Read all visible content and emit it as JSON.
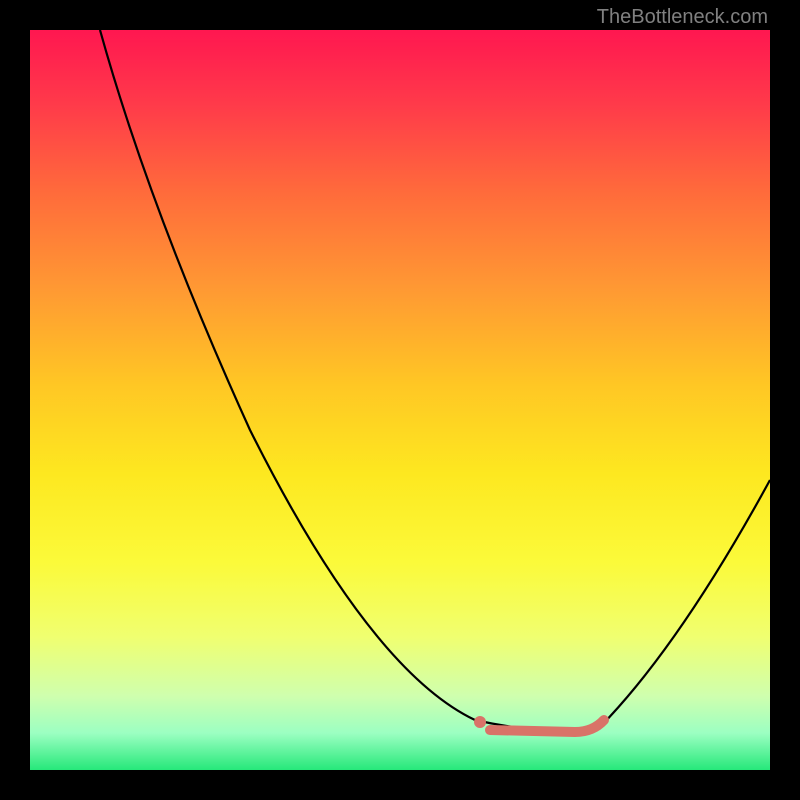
{
  "watermark": "TheBottleneck.com",
  "chart_data": {
    "type": "line",
    "title": "",
    "xlabel": "",
    "ylabel": "",
    "xlim": [
      0,
      100
    ],
    "ylim": [
      0,
      100
    ],
    "background_gradient": {
      "top": "#ff1750",
      "bottom": "#26e87a",
      "meaning": "red=high bottleneck, green=low bottleneck"
    },
    "series": [
      {
        "name": "bottleneck-curve",
        "x": [
          9,
          15,
          25,
          35,
          45,
          55,
          60,
          65,
          70,
          75,
          78,
          85,
          92,
          100
        ],
        "values": [
          100,
          85,
          65,
          48,
          32,
          15,
          8,
          4,
          3,
          3,
          4,
          12,
          25,
          40
        ]
      }
    ],
    "marker": {
      "name": "optimal-range",
      "x_start": 62,
      "x_end": 78,
      "y": 3,
      "color": "#d97368"
    },
    "grid": false,
    "legend": false
  }
}
